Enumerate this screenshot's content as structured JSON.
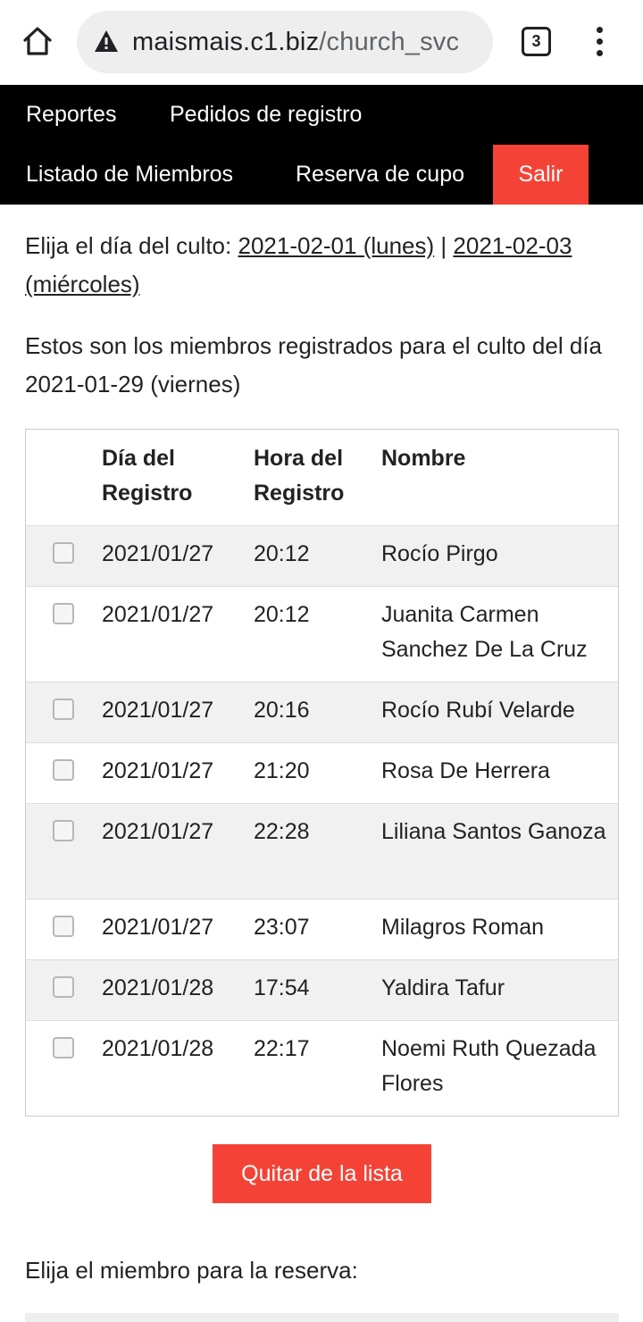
{
  "browser": {
    "url_host": "maismais.c1.biz",
    "url_path": "/church_svc",
    "tab_count": "3",
    "icons": [
      "home-icon",
      "warning-icon",
      "tabs-icon",
      "more-vert-icon"
    ]
  },
  "nav": {
    "reports": "Reportes",
    "registration_requests": "Pedidos de registro",
    "member_list": "Listado de Miembros",
    "seat_reservation": "Reserva de cupo",
    "logout": "Salir"
  },
  "day_choice": {
    "prompt": "Elija el día del culto:",
    "option_1": "2021-02-01 (lunes)",
    "separator": "|",
    "option_2": "2021-02-03 (miércoles)"
  },
  "intro": "Estos son los miembros registrados para el culto del día 2021-01-29 (viernes)",
  "table": {
    "headers": {
      "date": "Día del Registro",
      "time": "Hora del Registro",
      "name": "Nombre"
    },
    "rows": [
      {
        "date": "2021/01/27",
        "time": "20:12",
        "name": "Rocío Pirgo"
      },
      {
        "date": "2021/01/27",
        "time": "20:12",
        "name": "Juanita Carmen Sanchez De La Cruz"
      },
      {
        "date": "2021/01/27",
        "time": "20:16",
        "name": "Rocío Rubí Velarde"
      },
      {
        "date": "2021/01/27",
        "time": "21:20",
        "name": "Rosa De Herrera"
      },
      {
        "date": "2021/01/27",
        "time": "22:28",
        "name": "Liliana Santos Ganoza"
      },
      {
        "date": "2021/01/27",
        "time": "23:07",
        "name": "Milagros Roman"
      },
      {
        "date": "2021/01/28",
        "time": "17:54",
        "name": "Yaldira Tafur"
      },
      {
        "date": "2021/01/28",
        "time": "22:17",
        "name": "Noemi Ruth Quezada Flores"
      }
    ]
  },
  "remove_button": "Quitar de la lista",
  "member_choice_prompt": "Elija el miembro para la reserva:",
  "colors": {
    "accent": "#f44336",
    "nav_bg": "#000000",
    "row_alt": "#f1f1f1"
  }
}
